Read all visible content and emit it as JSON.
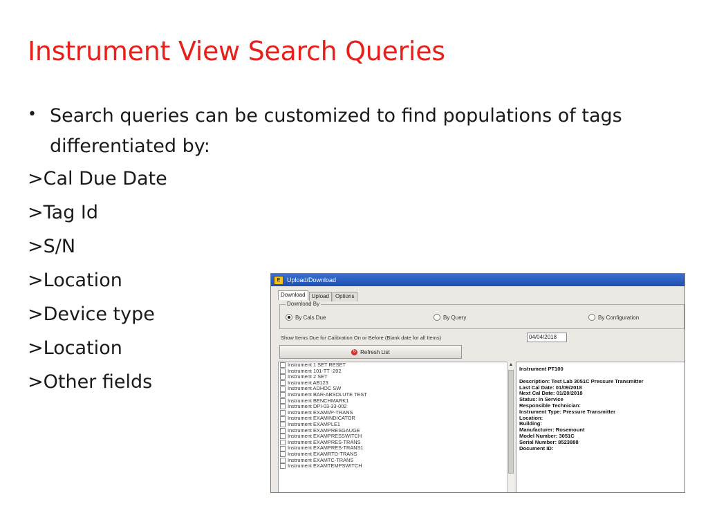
{
  "slide": {
    "title": "Instrument View Search Queries",
    "bullet": "Search queries can be customized to find populations of tags differentiated by:",
    "fields": [
      ">Cal Due Date",
      ">Tag Id",
      ">S/N",
      ">Location",
      ">Device type",
      ">Location",
      ">Other fields"
    ]
  },
  "window": {
    "title": "Upload/Download",
    "tabs": [
      "Download",
      "Upload",
      "Options"
    ],
    "group_label": "Download By",
    "radio_options": [
      "By Cals Due",
      "By Query",
      "By Configuration"
    ],
    "show_items_label": "Show Items Due for Calibration On or Before (Blank date for all Items)",
    "date_value": "04/04/2018",
    "refresh_label": "Refresh List",
    "instruments": [
      "Instrument 1 SET RESET",
      "Instrument 101-TT  -202",
      "Instrument 2 SET",
      "Instrument AB123",
      "Instrument ADHOC SW",
      "Instrument BAR-ABSOLUTE TEST",
      "Instrument BENCHMARK1",
      "Instrument DPI-03-33-002",
      "Instrument EXAMI/P-TRANS",
      "Instrument EXAMINDICATOR",
      "Instrument EXAMPLE1",
      "Instrument EXAMPRESGAUGE",
      "Instrument EXAMPRESSWITCH",
      "Instrument EXAMPRES-TRANS",
      "Instrument EXAMPRES-TRANS1",
      "Instrument EXAMRTD-TRANS",
      "Instrument EXAMTC-TRANS",
      "Instrument EXAMTEMPSWITCH"
    ],
    "details": {
      "heading": "Instrument PT100",
      "lines": [
        "Description: Test Lab 3051C Pressure Transmitter",
        "Last Cal Date: 01/09/2018",
        "Next Cal Date: 01/20/2018",
        "Status: In Service",
        "Responsible Technician:",
        "Instrument Type: Pressure Transmitter",
        "Location:",
        "Building:",
        "Manufacturer: Rosemount",
        "Model Number: 3051C",
        "Serial Number: 8523888",
        "Document ID:"
      ]
    }
  },
  "colors": {
    "title": "#e8201c",
    "titlebar": "#1d4fb0"
  }
}
